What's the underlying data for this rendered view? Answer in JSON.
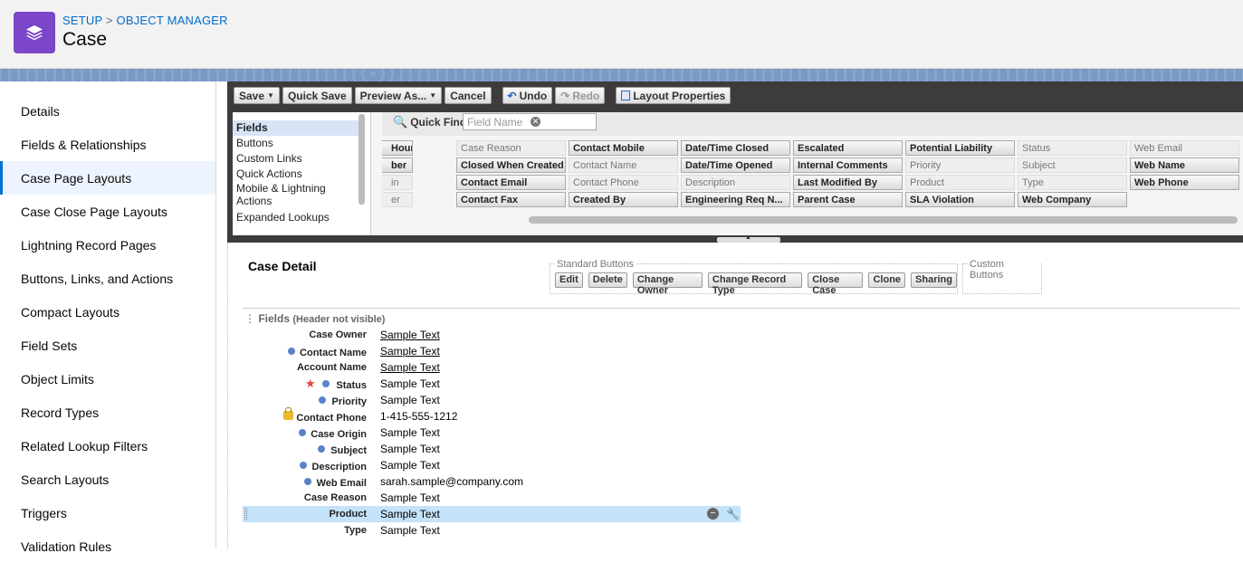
{
  "header": {
    "breadcrumb_setup": "SETUP",
    "breadcrumb_sep": ">",
    "breadcrumb_om": "OBJECT MANAGER",
    "title": "Case",
    "brand_color": "#7b46c9"
  },
  "sidebar": {
    "items": [
      {
        "label": "Details"
      },
      {
        "label": "Fields & Relationships"
      },
      {
        "label": "Case Page Layouts"
      },
      {
        "label": "Case Close Page Layouts"
      },
      {
        "label": "Lightning Record Pages"
      },
      {
        "label": "Buttons, Links, and Actions"
      },
      {
        "label": "Compact Layouts"
      },
      {
        "label": "Field Sets"
      },
      {
        "label": "Object Limits"
      },
      {
        "label": "Record Types"
      },
      {
        "label": "Related Lookup Filters"
      },
      {
        "label": "Search Layouts"
      },
      {
        "label": "Triggers"
      },
      {
        "label": "Validation Rules"
      }
    ],
    "active": "Case Page Layouts"
  },
  "toolbar": {
    "save": "Save",
    "quick_save": "Quick Save",
    "preview_as": "Preview As...",
    "cancel": "Cancel",
    "undo": "Undo",
    "redo": "Redo",
    "layout_properties": "Layout Properties"
  },
  "palette": {
    "categories": [
      "Fields",
      "Buttons",
      "Custom Links",
      "Quick Actions",
      "Mobile & Lightning Actions",
      "Expanded Lookups"
    ],
    "quick_find_label": "Quick Find",
    "quick_find_placeholder": "Field Name",
    "columns": [
      [
        "Hours",
        "ber",
        "in",
        "er"
      ],
      [
        "Case Reason",
        "Closed When Created",
        "Contact Email",
        "Contact Fax"
      ],
      [
        "Contact Mobile",
        "Contact Name",
        "Contact Phone",
        "Created By"
      ],
      [
        "Date/Time Closed",
        "Date/Time Opened",
        "Description",
        "Engineering Req N..."
      ],
      [
        "Escalated",
        "Internal Comments",
        "Last Modified By",
        "Parent Case"
      ],
      [
        "Potential Liability",
        "Priority",
        "Product",
        "SLA Violation"
      ],
      [
        "Status",
        "Subject",
        "Type",
        "Web Company"
      ],
      [
        "Web Email",
        "Web Name",
        "Web Phone",
        ""
      ]
    ]
  },
  "layout": {
    "section_title": "Case Detail",
    "standard_buttons_label": "Standard Buttons",
    "standard_buttons": [
      "Edit",
      "Delete",
      "Change Owner",
      "Change Record Type",
      "Close Case",
      "Clone",
      "Sharing"
    ],
    "custom_buttons_label": "Custom Buttons",
    "fields_label": "Fields",
    "fields_note": "(Header not visible)",
    "fields": [
      {
        "label": "Case Owner",
        "value": "Sample Text"
      },
      {
        "label": "Contact Name",
        "value": "Sample Text"
      },
      {
        "label": "Account Name",
        "value": "Sample Text"
      },
      {
        "label": "Status",
        "value": "Sample Text"
      },
      {
        "label": "Priority",
        "value": "Sample Text"
      },
      {
        "label": "Contact Phone",
        "value": "1-415-555-1212"
      },
      {
        "label": "Case Origin",
        "value": "Sample Text"
      },
      {
        "label": "Subject",
        "value": "Sample Text"
      },
      {
        "label": "Description",
        "value": "Sample Text"
      },
      {
        "label": "Web Email",
        "value": "sarah.sample@company.com"
      },
      {
        "label": "Case Reason",
        "value": "Sample Text"
      },
      {
        "label": "Product",
        "value": "Sample Text"
      },
      {
        "label": "Type",
        "value": "Sample Text"
      }
    ]
  }
}
